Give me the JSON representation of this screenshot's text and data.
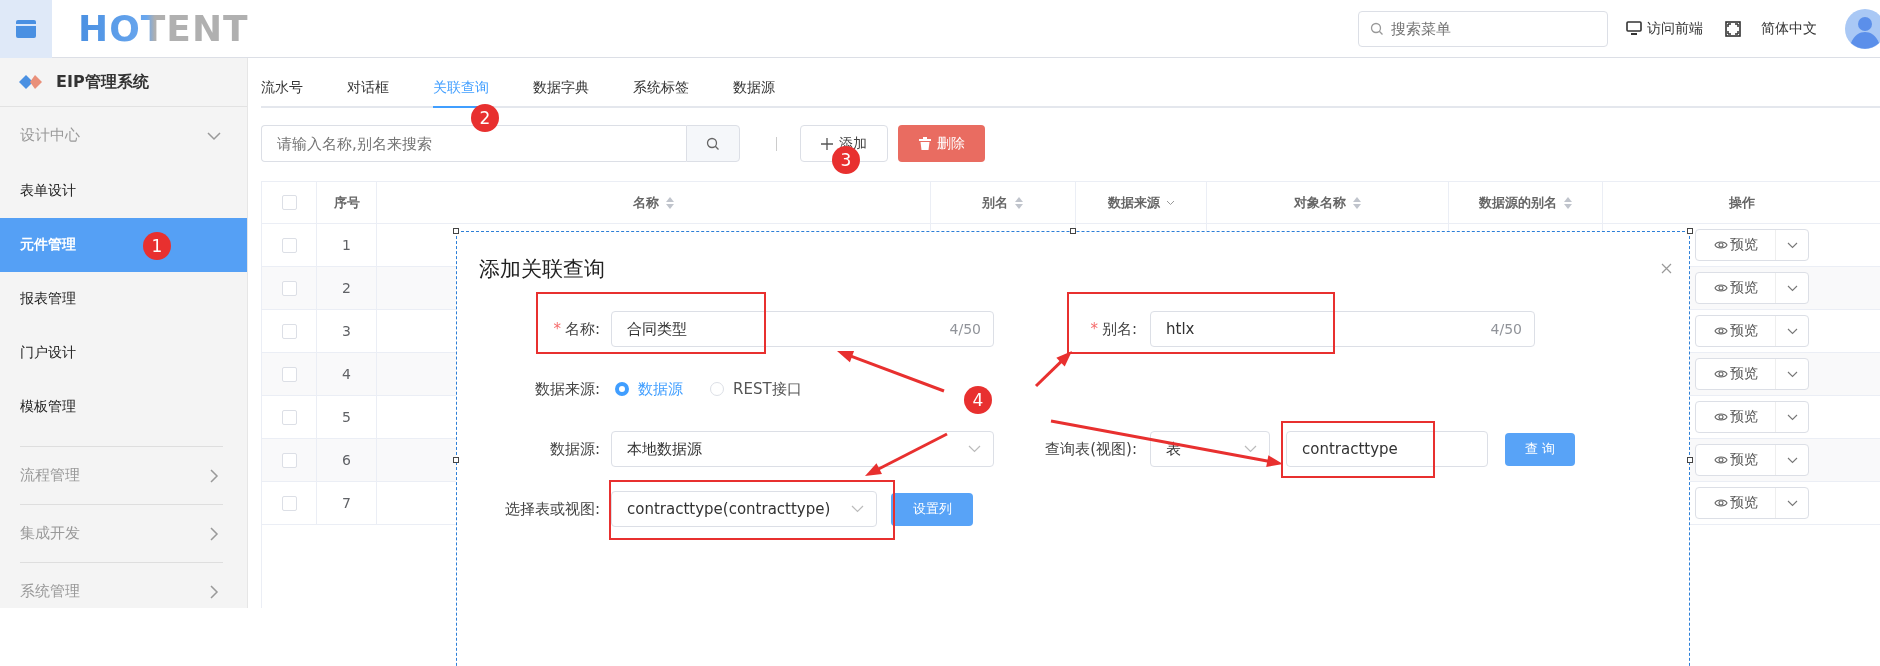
{
  "header": {
    "logo": "HOTENT",
    "search_placeholder": "搜索菜单",
    "visit_frontend": "访问前端",
    "language": "简体中文"
  },
  "sidebar": {
    "title": "EIP管理系统",
    "groups": [
      {
        "label": "设计中心",
        "expanded": true,
        "children": [
          {
            "label": "表单设计",
            "selected": false
          },
          {
            "label": "元件管理",
            "selected": true
          },
          {
            "label": "报表管理",
            "selected": false
          },
          {
            "label": "门户设计",
            "selected": false
          },
          {
            "label": "模板管理",
            "selected": false
          }
        ]
      },
      {
        "label": "流程管理",
        "expanded": false
      },
      {
        "label": "集成开发",
        "expanded": false
      },
      {
        "label": "系统管理",
        "expanded": false
      }
    ]
  },
  "tabs": [
    {
      "label": "流水号",
      "selected": false
    },
    {
      "label": "对话框",
      "selected": false
    },
    {
      "label": "关联查询",
      "selected": true
    },
    {
      "label": "数据字典",
      "selected": false
    },
    {
      "label": "系统标签",
      "selected": false
    },
    {
      "label": "数据源",
      "selected": false
    }
  ],
  "toolbar": {
    "search_placeholder": "请输入名称,别名来搜索",
    "add": "添加",
    "delete": "删除"
  },
  "table": {
    "all_checked": false,
    "columns": [
      {
        "label": "序号",
        "kind": "plain"
      },
      {
        "label": "名称",
        "kind": "sortable"
      },
      {
        "label": "别名",
        "kind": "sortable"
      },
      {
        "label": "数据来源",
        "kind": "filter"
      },
      {
        "label": "对象名称",
        "kind": "sortable"
      },
      {
        "label": "数据源的别名",
        "kind": "sortable"
      },
      {
        "label": "操作",
        "kind": "plain"
      }
    ],
    "rows": [
      {
        "index": "1",
        "checked": false,
        "action": "预览"
      },
      {
        "index": "2",
        "checked": false,
        "action": "预览"
      },
      {
        "index": "3",
        "checked": false,
        "action": "预览"
      },
      {
        "index": "4",
        "checked": false,
        "action": "预览"
      },
      {
        "index": "5",
        "checked": false,
        "action": "预览"
      },
      {
        "index": "6",
        "checked": false,
        "action": "预览"
      },
      {
        "index": "7",
        "checked": false,
        "action": "预览"
      }
    ]
  },
  "dialog": {
    "title": "添加关联查询",
    "name": {
      "label": "名称:",
      "required_mark": "*",
      "value": "合同类型",
      "count": "4/50"
    },
    "alias": {
      "label": "别名:",
      "required_mark": "*",
      "value": "htlx",
      "count": "4/50"
    },
    "source": {
      "label": "数据来源:",
      "options": [
        {
          "label": "数据源",
          "selected": true
        },
        {
          "label": "REST接口",
          "selected": false
        }
      ]
    },
    "datasource": {
      "label": "数据源:",
      "value": "本地数据源"
    },
    "query": {
      "label": "查询表(视图):",
      "type": "表",
      "value": "contracttype",
      "button": "查 询"
    },
    "table_select": {
      "label": "选择表或视图:",
      "value": "contracttype(contracttype)",
      "button": "设置列"
    }
  },
  "annotations": [
    "1",
    "2",
    "3",
    "4"
  ]
}
